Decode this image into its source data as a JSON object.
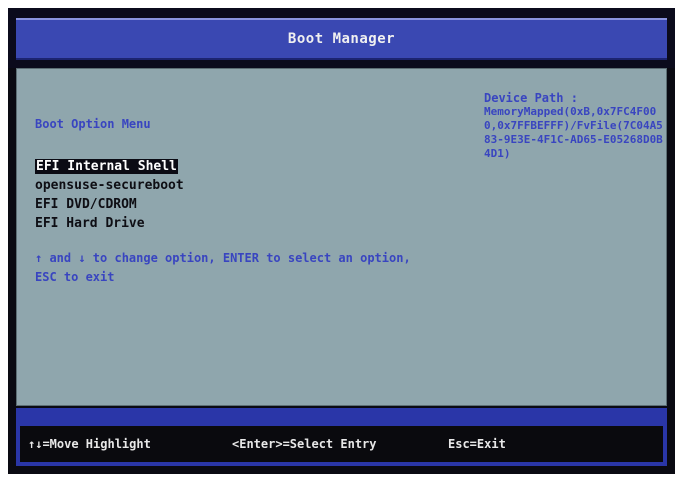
{
  "header": {
    "title": "Boot Manager"
  },
  "menu": {
    "heading": "Boot Option Menu",
    "options": [
      {
        "label": "EFI Internal Shell",
        "selected": true
      },
      {
        "label": "opensuse-secureboot",
        "selected": false
      },
      {
        "label": "EFI DVD/CDROM",
        "selected": false
      },
      {
        "label": "EFI Hard Drive",
        "selected": false
      }
    ],
    "help_line1": "↑ and ↓ to change option, ENTER to select an option,",
    "help_line2": "ESC to exit"
  },
  "device_path": {
    "label": "Device Path :",
    "value": "MemoryMapped(0xB,0x7FC4F000,0x7FFBEFFF)/FvFile(7C04A583-9E3E-4F1C-AD65-E05268D0B4D1)"
  },
  "footer": {
    "move": "↑↓=Move Highlight",
    "select": "<Enter>=Select Entry",
    "exit": "Esc=Exit"
  },
  "colors": {
    "header_blue": "#3a48b2",
    "body_grey": "#8fa6ad",
    "text_blue": "#3945c0",
    "footer_blue": "#2a36a8"
  }
}
